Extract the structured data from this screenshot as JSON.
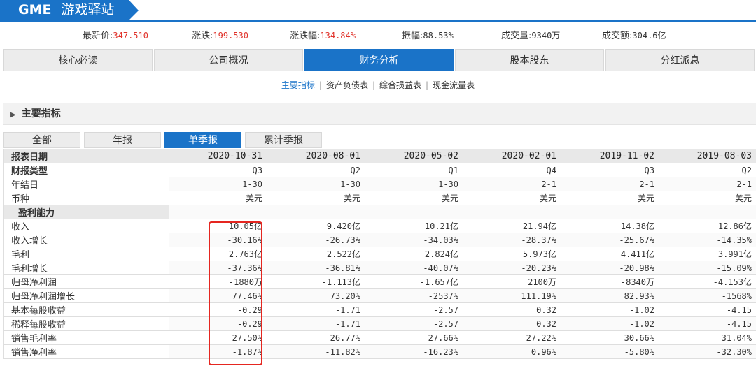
{
  "header": {
    "ticker": "GME",
    "name": "游戏驿站"
  },
  "quote": [
    {
      "label": "最新价:",
      "value": "347.510",
      "red": true
    },
    {
      "label": "涨跌:",
      "value": "199.530",
      "red": true
    },
    {
      "label": "涨跌幅:",
      "value": "134.84%",
      "red": true
    },
    {
      "label": "振幅:",
      "value": "88.53%",
      "red": false
    },
    {
      "label": "成交量:",
      "value": "9340万",
      "red": false
    },
    {
      "label": "成交额:",
      "value": "304.6亿",
      "red": false
    }
  ],
  "tabs": [
    "核心必读",
    "公司概况",
    "财务分析",
    "股本股东",
    "分红派息"
  ],
  "active_tab": 2,
  "subnav": [
    "主要指标",
    "资产负债表",
    "综合损益表",
    "现金流量表"
  ],
  "subnav_active": 0,
  "section_title": "主要指标",
  "period_tabs": [
    "全部",
    "年报",
    "单季报",
    "累计季报"
  ],
  "period_active": 2,
  "table": {
    "header_label": "报表日期",
    "dates": [
      "2020-10-31",
      "2020-08-01",
      "2020-05-02",
      "2020-02-01",
      "2019-11-02",
      "2019-08-03"
    ],
    "rows": [
      {
        "label": "财报类型",
        "bold": true,
        "values": [
          "Q3",
          "Q2",
          "Q1",
          "Q4",
          "Q3",
          "Q2"
        ]
      },
      {
        "label": "年结日",
        "values": [
          "1-30",
          "1-30",
          "1-30",
          "2-1",
          "2-1",
          "2-1"
        ]
      },
      {
        "label": "币种",
        "values": [
          "美元",
          "美元",
          "美元",
          "美元",
          "美元",
          "美元"
        ]
      },
      {
        "label": "盈利能力",
        "group": true,
        "values": [
          "",
          "",
          "",
          "",
          "",
          ""
        ]
      },
      {
        "label": "收入",
        "values": [
          "10.05亿",
          "9.420亿",
          "10.21亿",
          "21.94亿",
          "14.38亿",
          "12.86亿"
        ]
      },
      {
        "label": "收入增长",
        "values": [
          "-30.16%",
          "-26.73%",
          "-34.03%",
          "-28.37%",
          "-25.67%",
          "-14.35%"
        ]
      },
      {
        "label": "毛利",
        "values": [
          "2.763亿",
          "2.522亿",
          "2.824亿",
          "5.973亿",
          "4.411亿",
          "3.991亿"
        ]
      },
      {
        "label": "毛利增长",
        "values": [
          "-37.36%",
          "-36.81%",
          "-40.07%",
          "-20.23%",
          "-20.98%",
          "-15.09%"
        ]
      },
      {
        "label": "归母净利润",
        "values": [
          "-1880万",
          "-1.113亿",
          "-1.657亿",
          "2100万",
          "-8340万",
          "-4.153亿"
        ]
      },
      {
        "label": "归母净利润增长",
        "values": [
          "77.46%",
          "73.20%",
          "-2537%",
          "111.19%",
          "82.93%",
          "-1568%"
        ]
      },
      {
        "label": "基本每股收益",
        "values": [
          "-0.29",
          "-1.71",
          "-2.57",
          "0.32",
          "-1.02",
          "-4.15"
        ]
      },
      {
        "label": "稀释每股收益",
        "values": [
          "-0.29",
          "-1.71",
          "-2.57",
          "0.32",
          "-1.02",
          "-4.15"
        ]
      },
      {
        "label": "销售毛利率",
        "values": [
          "27.50%",
          "26.77%",
          "27.66%",
          "27.22%",
          "30.66%",
          "31.04%"
        ]
      },
      {
        "label": "销售净利率",
        "values": [
          "-1.87%",
          "-11.82%",
          "-16.23%",
          "0.96%",
          "-5.80%",
          "-32.30%"
        ]
      }
    ]
  },
  "colors": {
    "accent": "#1a73c8",
    "red": "#e0322a",
    "highlight": "#e52620"
  }
}
